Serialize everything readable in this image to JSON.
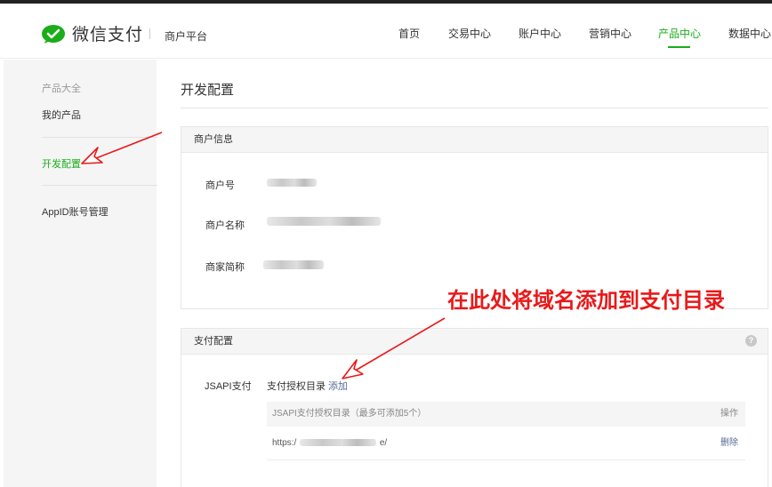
{
  "header": {
    "logo_text": "微信支付",
    "sub_title": "商户平台",
    "nav": [
      {
        "label": "首页",
        "active": false
      },
      {
        "label": "交易中心",
        "active": false
      },
      {
        "label": "账户中心",
        "active": false
      },
      {
        "label": "营销中心",
        "active": false
      },
      {
        "label": "产品中心",
        "active": true
      },
      {
        "label": "数据中心",
        "active": false
      }
    ]
  },
  "sidebar": {
    "category": "产品大全",
    "items": [
      {
        "label": "我的产品",
        "active": false
      },
      {
        "label": "开发配置",
        "active": true
      },
      {
        "label": "AppID账号管理",
        "active": false
      }
    ]
  },
  "page": {
    "title": "开发配置"
  },
  "merchant_info": {
    "heading": "商户信息",
    "rows": [
      {
        "label": "商户号"
      },
      {
        "label": "商户名称"
      },
      {
        "label": "商家简称"
      }
    ]
  },
  "payment_config": {
    "heading": "支付配置",
    "help_glyph": "?",
    "jsapi_label": "JSAPI支付",
    "dir_label": "支付授权目录",
    "add_label": "添加",
    "table_header": "JSAPI支付授权目录（最多可添加5个）",
    "table_op_header": "操作",
    "rows": [
      {
        "url_prefix": "https:/",
        "url_suffix": "e/",
        "action": "删除"
      }
    ]
  },
  "annotation": {
    "text": "在此处将域名添加到支付目录"
  },
  "colors": {
    "brand_green": "#1aad19",
    "link_blue": "#576b95",
    "annotation_red": "#e8191a"
  }
}
